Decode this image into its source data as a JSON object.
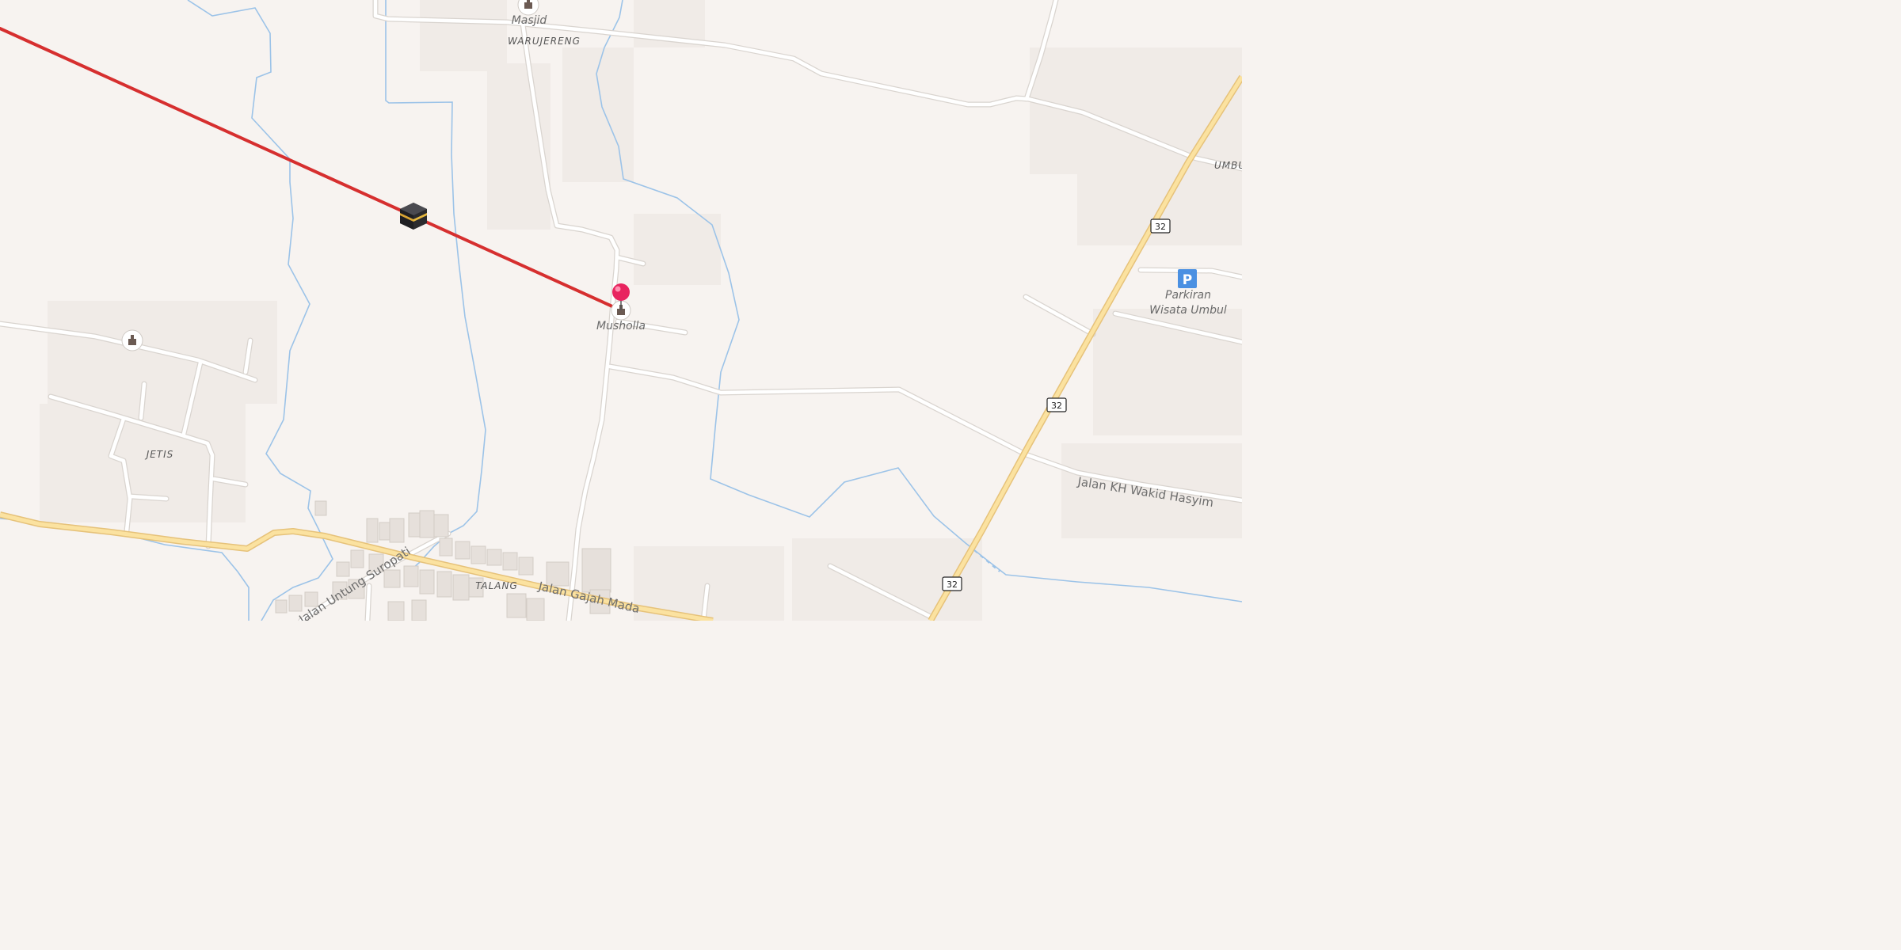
{
  "map": {
    "colors": {
      "background": "#f7f3f0",
      "road_minor": "#ffffff",
      "road_casing": "#d9d4cf",
      "road_primary": "#fbe2a0",
      "road_primary_casing": "#e6c27a",
      "water": "#9cc3e8",
      "qibla_line": "#d62f2f",
      "pin": "#e8245f",
      "parking": "#4a90e2"
    },
    "places": {
      "warujereng": "WARUJERENG",
      "jetis": "JETIS",
      "talang": "TALANG",
      "umbul": "UMBUL"
    },
    "pois": {
      "masjid": "Masjid",
      "musholla": "Musholla",
      "parking_line1": "Parkiran",
      "parking_line2": "Wisata Umbul",
      "parking_symbol": "P"
    },
    "streets": {
      "kh_wakid_hasyim": "Jalan KH Wakid Hasyim",
      "gajah_mada": "Jalan Gajah Mada",
      "untung_suropati": "Jalan Untung Suropati"
    },
    "route_shields": [
      "32",
      "32",
      "32"
    ],
    "icons": {
      "kaaba": "kaaba-icon",
      "mosque": "mosque-icon",
      "pin": "location-pin-icon",
      "parking": "parking-icon"
    }
  }
}
